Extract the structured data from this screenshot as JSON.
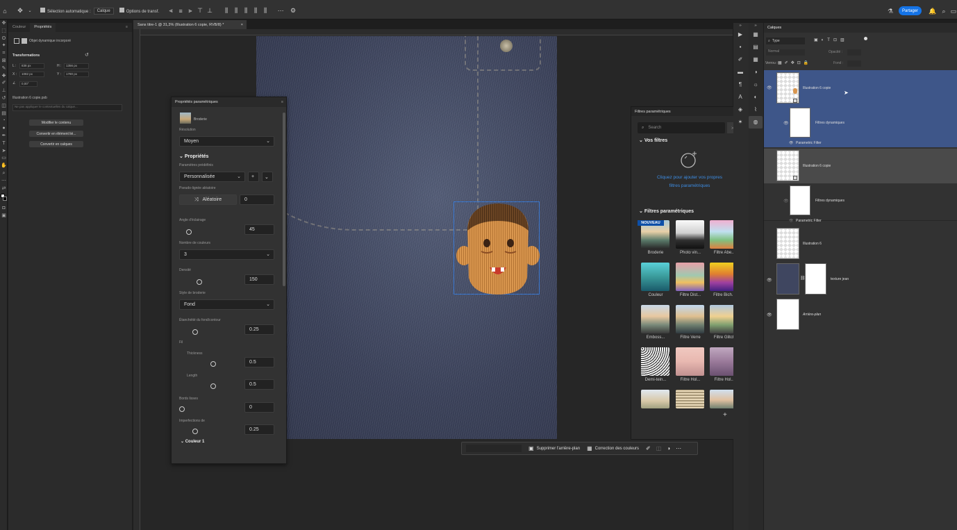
{
  "options_bar": {
    "auto_select": "Sélection automatique :",
    "auto_select_value": "Calque",
    "transform_options": "Options de transf.",
    "share": "Partager"
  },
  "left_panel": {
    "tab_color": "Couleur",
    "tab_properties": "Propriétés",
    "smart_object": "Objet dynamique incorporé",
    "transform_heading": "Transformations",
    "w_label": "L :",
    "w_value": "838 px",
    "h_label": "H :",
    "h_value": "1356 px",
    "x_label": "X :",
    "x_value": "1082 px",
    "y_label": "Y :",
    "y_value": "1780 px",
    "angle_value": "0,00°",
    "file_name": "Illustration 6 copie.psb",
    "file_note": "Ne pas appliquer le contextuelles du calque...",
    "btn_edit": "Modifier le contenu",
    "btn_convert_linked": "Convertir en élément lié...",
    "btn_convert_layers": "Convertir en calques"
  },
  "document_tab": "Sans titre-1 @ 31,3% (Illustration 6 copie, RVB/8) *",
  "param_panel": {
    "title": "Propriétés paramétriques",
    "filter_name": "Broderie",
    "resolution_label": "Résolution",
    "resolution_value": "Moyen",
    "section_properties": "Propriétés",
    "presets_label": "Paramètres prédéfinis",
    "presets_value": "Personnalisée",
    "seed_label": "Pseudo-lignée aléatoire",
    "random_btn": "Aléatoire",
    "seed_value": "0",
    "angle_label": "Angle d'éclairage",
    "angle_value": "45",
    "colors_label": "Nombre de couleurs",
    "colors_value": "3",
    "density_label": "Densité",
    "density_value": "150",
    "style_label": "Style de broderie",
    "style_value": "Fond",
    "smooth_label": "Étanchéité du fond/contour",
    "smooth_value": "0.25",
    "thread_label": "Fil",
    "thickness_label": "Thickness",
    "thickness_value": "0.5",
    "length_label": "Length",
    "length_value": "0.5",
    "borders_label": "Bords lisses",
    "borders_value": "0",
    "imperf_label": "Imperfections de",
    "imperf_value": "0.25",
    "color1_label": "Couleur 1"
  },
  "filters_panel": {
    "title": "Filtres paramétriques",
    "search_placeholder": "Search",
    "your_filters": "Vos filtres",
    "cta": "Cliquez pour ajouter vos propres filtres paramétriques",
    "param_filters": "Filtres paramétriques",
    "new_badge": "NOUVEAU",
    "items": [
      "Broderie",
      "Photo vin...",
      "Filtre Abe...",
      "Couleur",
      "Filtre Dist...",
      "Filtre Bich...",
      "Emboss...",
      "Filtre Verre",
      "Filtre Glitch",
      "Demi-tein...",
      "Filtre Hol...",
      "Filtre Hol..."
    ]
  },
  "ctx_bar": {
    "remove_bg": "Supprimer l'arrière-plan",
    "color_correct": "Correction des couleurs"
  },
  "layers_panel": {
    "tab": "Calques",
    "kind": "Type",
    "blend": "Normal",
    "opacity_label": "Opacité :",
    "lock_label": "Verrou :",
    "fill_label": "Fond :",
    "layers": [
      {
        "name": "Illustration 6 copie"
      },
      {
        "name": "Filtres dynamiques"
      },
      {
        "name": "Parametric Filter"
      },
      {
        "name": "Illustration 6 copie"
      },
      {
        "name": "Filtres dynamiques"
      },
      {
        "name": "Parametric Filter"
      },
      {
        "name": "Illustration 6"
      },
      {
        "name": "texture jean"
      },
      {
        "name": "Arrière-plan"
      }
    ]
  }
}
